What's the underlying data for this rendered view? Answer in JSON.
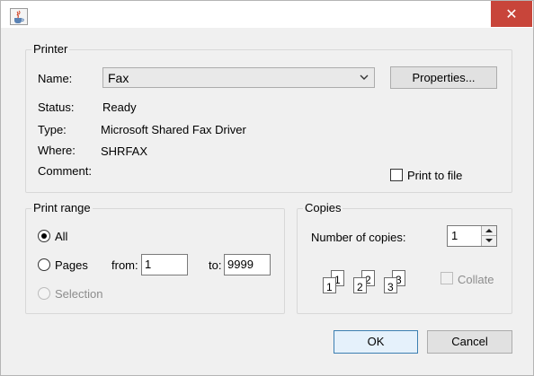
{
  "printer": {
    "legend": "Printer",
    "name_label": "Name:",
    "name_value": "Fax",
    "properties_button": "Properties...",
    "status_label": "Status:",
    "status_value": "Ready",
    "type_label": "Type:",
    "type_value": "Microsoft Shared Fax Driver",
    "where_label": "Where:",
    "where_value": "SHRFAX",
    "comment_label": "Comment:",
    "print_to_file": "Print to file"
  },
  "print_range": {
    "legend": "Print range",
    "all_label": "All",
    "pages_label": "Pages",
    "from_label": "from:",
    "from_value": "1",
    "to_label": "to:",
    "to_value": "9999",
    "selection_label": "Selection",
    "selected": "all"
  },
  "copies": {
    "legend": "Copies",
    "number_label": "Number of copies:",
    "number_value": "1",
    "collate_label": "Collate",
    "collate_pages": [
      "1",
      "2",
      "3"
    ]
  },
  "buttons": {
    "ok": "OK",
    "cancel": "Cancel"
  },
  "title_bar": {
    "close_glyph": "✕",
    "app_icon": "java-coffee-icon"
  },
  "colors": {
    "close_button": "#c8453a",
    "default_button_border": "#3c7fb1"
  }
}
